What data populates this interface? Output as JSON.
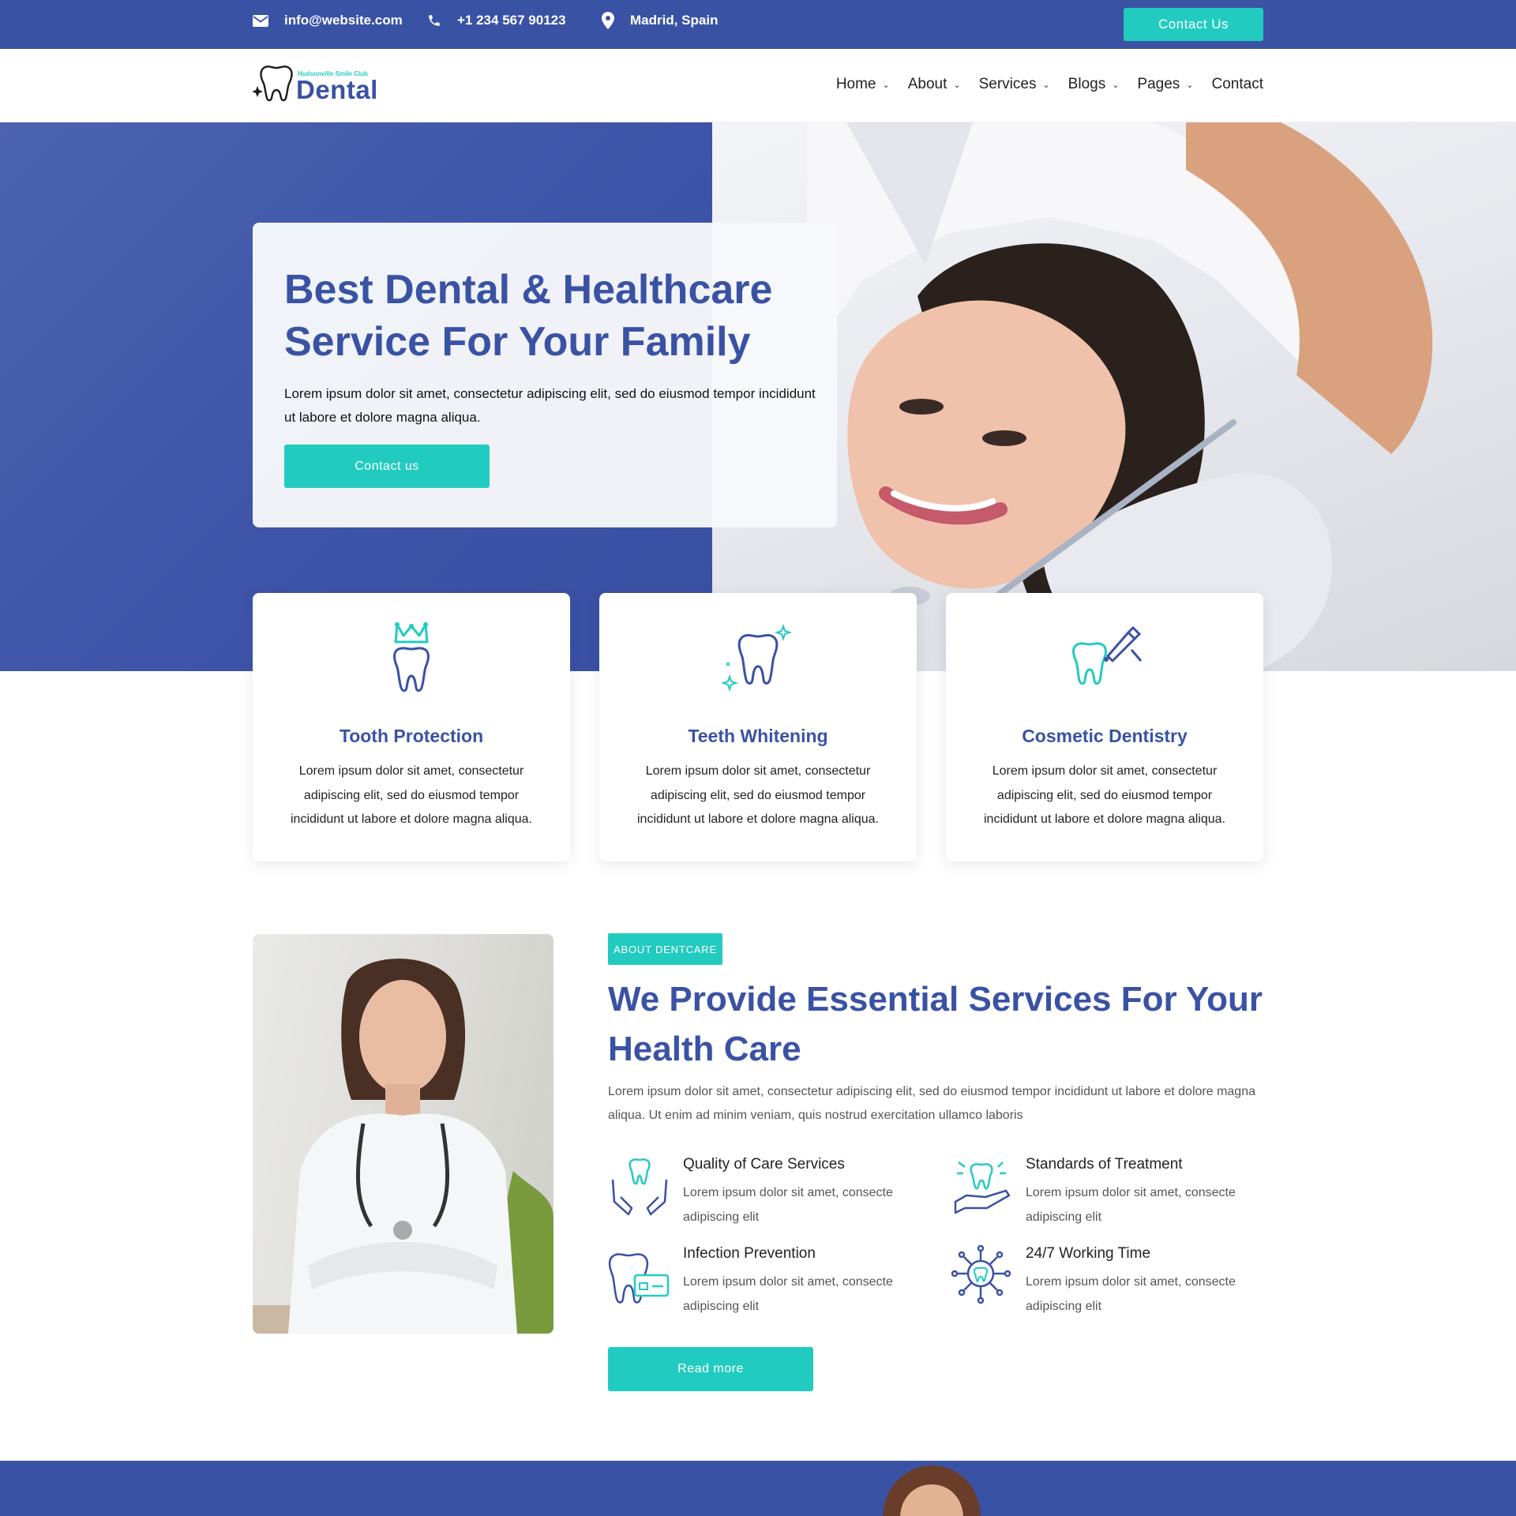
{
  "colors": {
    "primary": "#3a52a4",
    "accent": "#22cbc0",
    "text": "#222222",
    "muted": "#555555"
  },
  "topbar": {
    "email": "info@website.com",
    "phone": "+1 234 567 90123",
    "location": "Madrid, Spain",
    "contact_button": "Contact Us",
    "icons": [
      "envelope-icon",
      "phone-icon",
      "map-pin-icon"
    ]
  },
  "header": {
    "logo": {
      "tagline": "Hudsonville Smile Club",
      "brand": "Dental"
    },
    "nav": [
      {
        "label": "Home",
        "has_dropdown": true
      },
      {
        "label": "About",
        "has_dropdown": true
      },
      {
        "label": "Services",
        "has_dropdown": true
      },
      {
        "label": "Blogs",
        "has_dropdown": true
      },
      {
        "label": "Pages",
        "has_dropdown": true
      },
      {
        "label": "Contact",
        "has_dropdown": false
      }
    ]
  },
  "hero": {
    "title": "Best Dental & Healthcare Service For Your Family",
    "text": "Lorem ipsum dolor sit amet, consectetur adipiscing elit, sed do eiusmod tempor incididunt ut labore et dolore magna aliqua.",
    "button": "Contact us"
  },
  "features": [
    {
      "icon": "tooth-crown-icon",
      "title": "Tooth Protection",
      "text": "Lorem ipsum dolor sit amet, consectetur adipiscing elit, sed do eiusmod tempor incididunt ut labore et dolore magna aliqua."
    },
    {
      "icon": "tooth-sparkle-icon",
      "title": "Teeth Whitening",
      "text": "Lorem ipsum dolor sit amet, consectetur adipiscing elit, sed do eiusmod tempor incididunt ut labore et dolore magna aliqua."
    },
    {
      "icon": "tooth-drill-icon",
      "title": "Cosmetic Dentistry",
      "text": "Lorem ipsum dolor sit amet, consectetur adipiscing elit, sed do eiusmod tempor incididunt ut labore et dolore magna aliqua."
    }
  ],
  "about": {
    "badge": "ABOUT DENTCARE",
    "title": "We Provide Essential Services For Your Health Care",
    "text": "Lorem ipsum dolor sit amet, consectetur adipiscing elit, sed do eiusmod tempor incididunt ut labore et dolore magna aliqua. Ut enim ad minim veniam, quis nostrud exercitation ullamco laboris",
    "services": [
      {
        "icon": "tooth-hands-icon",
        "title": "Quality of Care Services",
        "text": "Lorem ipsum dolor sit amet, consecte adipiscing elit"
      },
      {
        "icon": "tooth-hand-icon",
        "title": "Standards of Treatment",
        "text": "Lorem ipsum dolor sit amet, consecte adipiscing elit"
      },
      {
        "icon": "tooth-card-icon",
        "title": "Infection Prevention",
        "text": "Lorem ipsum dolor sit amet, consecte adipiscing elit"
      },
      {
        "icon": "tooth-network-icon",
        "title": "24/7 Working Time",
        "text": "Lorem ipsum dolor sit amet, consecte adipiscing elit"
      }
    ],
    "button": "Read more"
  }
}
